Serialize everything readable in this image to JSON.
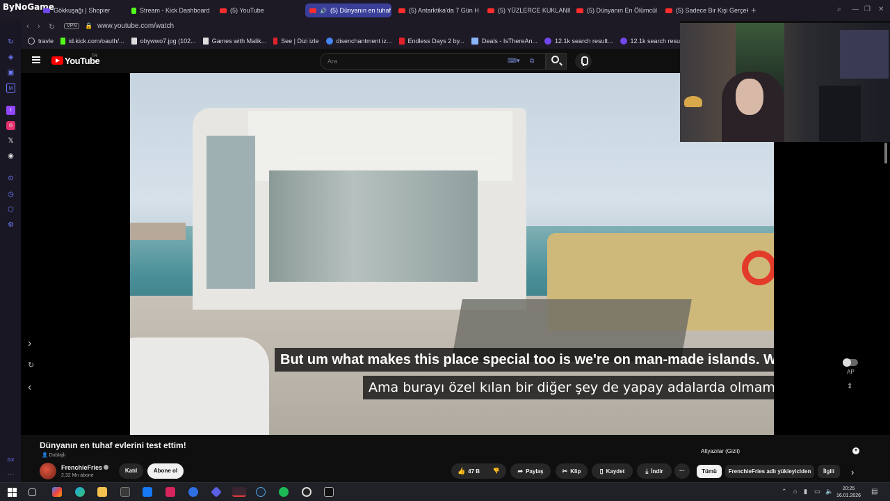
{
  "browser": {
    "brand": "ByNoGame",
    "tabs": [
      {
        "label": "Gökkuşağı | Shopier",
        "icon": "purple-favicon",
        "active": false
      },
      {
        "label": "Stream - Kick Dashboard",
        "icon": "kick-favicon",
        "active": false
      },
      {
        "label": "(5) YouTube",
        "icon": "youtube-favicon",
        "active": false
      },
      {
        "label": "(5) Dünyanın en tuhaf",
        "icon": "youtube-favicon",
        "active": true
      },
      {
        "label": "(5) Antarktika'da 7 Gün H",
        "icon": "youtube-favicon",
        "active": false
      },
      {
        "label": "(5) YÜZLERCE KUKLANIN",
        "icon": "youtube-favicon",
        "active": false
      },
      {
        "label": "(5) Dünyanın En Ölümcül H",
        "icon": "youtube-favicon",
        "active": false
      },
      {
        "label": "(5) Sadece Bir Kişi Gerçek",
        "icon": "youtube-favicon",
        "active": false
      }
    ],
    "vpn_label": "VPN",
    "url": "www.youtube.com/watch",
    "bookmarks": [
      {
        "label": "travle"
      },
      {
        "label": "id.kick.com/oauth/..."
      },
      {
        "label": "obywwo7.jpg (102..."
      },
      {
        "label": "Games with Malik..."
      },
      {
        "label": "See | Dizi izle"
      },
      {
        "label": "disenchantment iz..."
      },
      {
        "label": "Endless Days 2 by..."
      },
      {
        "label": "Deals - IsThereAn..."
      },
      {
        "label": "12.1k search result..."
      },
      {
        "label": "12.1k search result..."
      }
    ]
  },
  "youtube": {
    "logo_text": "YouTube",
    "region": "TR",
    "search_placeholder": "Ara",
    "subtitle_en": "But um what makes this place special too is we're on man-made islands. We're in",
    "subtitle_tr": "Ama burayı özel kılan bir diğer şey de yapay adalarda olmamız.",
    "autoplay_label": "AP",
    "video_title": "Dünyanın en tuhaf evlerini test ettim!",
    "dubbed_label": "Dublajlı",
    "channel_name": "FrenchieFries",
    "subscribers": "2,32 Mn abone",
    "join_label": "Katıl",
    "subscribe_label": "Abone ol",
    "likes": "47 B",
    "share_label": "Paylaş",
    "clip_label": "Klip",
    "save_label": "Kaydet",
    "download_label": "İndir",
    "captions_panel_title": "Altyazılar (Gizli)",
    "chips": [
      "Tümü",
      "FrenchieFries adlı yükleyiciden",
      "İlgili"
    ]
  },
  "taskbar": {
    "time": "20:25",
    "date": "16.01.2026"
  },
  "colors": {
    "youtube_red": "#ff0000",
    "active_tab": "#3a3f9a",
    "background": "#0f0f0f"
  }
}
